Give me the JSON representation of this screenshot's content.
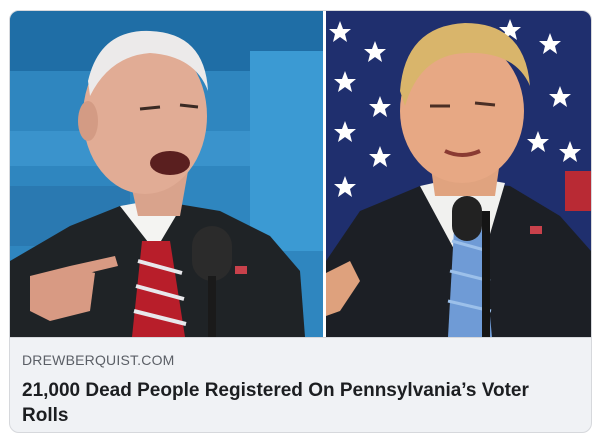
{
  "link_card": {
    "domain": "DREWBERQUIST.COM",
    "headline": "21,000 Dead People Registered On Pennsylvania’s Voter Rolls",
    "image": {
      "left_panel": "photo of a speaker in dark suit and red striped tie at a microphone, blue stage backdrop",
      "right_panel": "photo of a speaker in dark suit and blue tie at a microphone, american flag backdrop with white stars"
    }
  },
  "colors": {
    "card_background": "#f0f2f5",
    "card_border": "#d6d8dc",
    "domain_text": "#5b5f66",
    "headline_text": "#1c1e21",
    "left_backdrop": "#2f86bf",
    "right_backdrop": "#1f2f6e",
    "left_tie": "#b81e2a",
    "right_tie": "#6f9bd6"
  }
}
